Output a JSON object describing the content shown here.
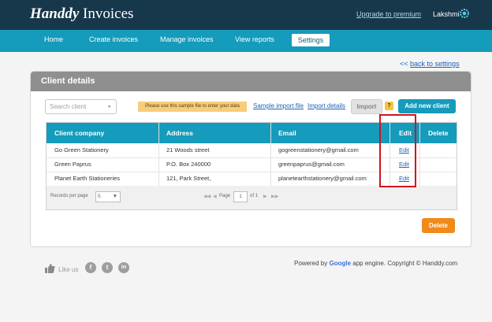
{
  "header": {
    "logo_brand": "Handdy",
    "logo_product": "Invoices",
    "upgrade_link": "Upgrade to premium",
    "user_name": "Lakshmi"
  },
  "nav": {
    "items": [
      "Home",
      "Create invoices",
      "Manage invoices",
      "View reports",
      "Settings"
    ],
    "active": "Settings"
  },
  "back_link": {
    "arrow": "<<",
    "label": "back to settings"
  },
  "panel": {
    "title": "Client details",
    "search_placeholder": "Search client",
    "sample_note": "Please use this sample file to enter your data",
    "sample_link": "Sample import file",
    "import_details_link": "Import details",
    "import_button": "Import",
    "help_label": "?",
    "add_client_button": "Add new client"
  },
  "table": {
    "columns": [
      "Client company",
      "Address",
      "Email",
      "Edit",
      "Delete"
    ],
    "rows": [
      {
        "company": "Go Green Stationery",
        "address": "21 Woods street",
        "email": "gogreenstationery@gmail.com",
        "edit": "Edit"
      },
      {
        "company": "Green Paprus",
        "address": "P.O. Box 240000",
        "email": "greenpaprus@gmail.com",
        "edit": "Edit"
      },
      {
        "company": "Planet Earth Stationeries",
        "address": "121, Park Street,",
        "email": "planetearthstationery@gmail.com",
        "edit": "Edit"
      }
    ]
  },
  "pager": {
    "records_label": "Records per page",
    "records_value": "5",
    "page_label": "Page",
    "page_value": "1",
    "of_label": "of 1"
  },
  "delete_button": "Delete",
  "footer": {
    "like_us": "Like us",
    "powered_prefix": "Powered by",
    "google_word": "Google",
    "powered_suffix": "app engine. Copyright © Handdy.com"
  },
  "colors": {
    "header_bg": "#17374a",
    "nav_bg": "#159bbb",
    "accent_orange": "#f08a1a",
    "highlight_red": "#d4131d",
    "link_blue": "#2062b2"
  },
  "icons": [
    "gear-icon",
    "search-arrow-icon",
    "help-icon",
    "first-page-icon",
    "prev-page-icon",
    "next-page-icon",
    "last-page-icon",
    "thumbs-up-icon",
    "facebook-icon",
    "twitter-icon",
    "linkedin-icon"
  ]
}
